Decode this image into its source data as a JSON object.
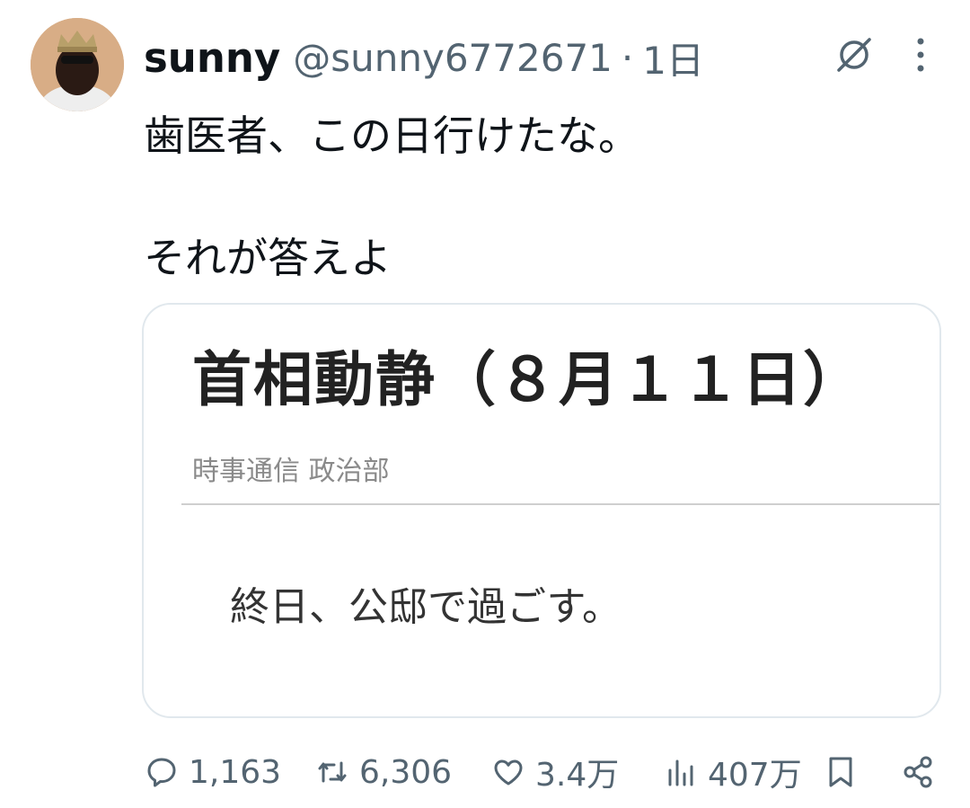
{
  "user": {
    "display_name": "sunny",
    "handle": "@sunny6772671",
    "separator": "·",
    "time": "1日",
    "avatar": "avatar-photo"
  },
  "tweet": {
    "line1": "歯医者、この日行けたな。",
    "line2": "それが答えよ"
  },
  "card": {
    "title": "首相動静（８月１１日）",
    "byline": "時事通信 政治部",
    "text": "終日、公邸で過ごす。"
  },
  "actions": {
    "replies": "1,163",
    "retweets": "6,306",
    "likes": "3.4万",
    "views": "407万"
  },
  "icons": {
    "grok": "grok-icon",
    "more": "more-vertical-icon",
    "reply": "reply-icon",
    "retweet": "retweet-icon",
    "like": "heart-icon",
    "views": "views-chart-icon",
    "bookmark": "bookmark-icon",
    "share": "share-icon"
  },
  "colors": {
    "text": "#0f1419",
    "secondary": "#536471",
    "border": "#e1e8ed"
  }
}
